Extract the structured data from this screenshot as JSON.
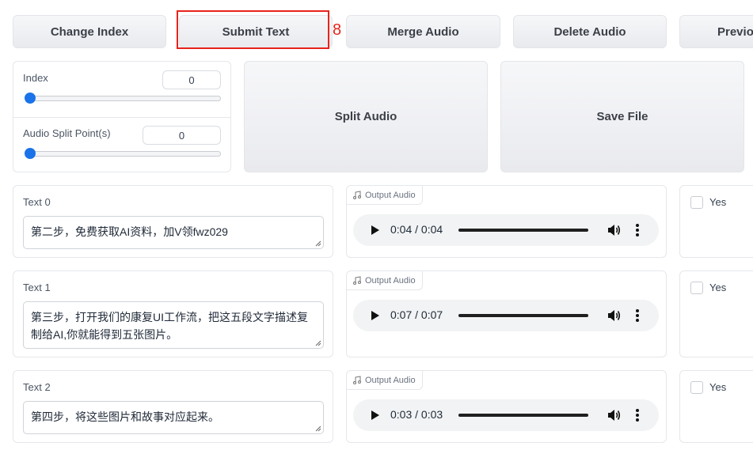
{
  "toolbar": {
    "change_index": "Change Index",
    "submit_text": "Submit Text",
    "merge_audio": "Merge Audio",
    "delete_audio": "Delete Audio",
    "previous": "Previo",
    "annotation_number": "8"
  },
  "controls": {
    "index_label": "Index",
    "index_value": "0",
    "split_label": "Audio Split Point(s)",
    "split_value": "0",
    "split_audio": "Split Audio",
    "save_file": "Save File"
  },
  "rows": [
    {
      "text_label": "Text 0",
      "text_value": "第二步，免费获取AI资料，加V领fwz029",
      "audio_label": "Output Audio",
      "time": "0:04 / 0:04",
      "check_label": "Yes"
    },
    {
      "text_label": "Text 1",
      "text_value": "第三步，打开我们的康复UI工作流，把这五段文字描述复制给AI,你就能得到五张图片。",
      "audio_label": "Output Audio",
      "time": "0:07 / 0:07",
      "check_label": "Yes"
    },
    {
      "text_label": "Text 2",
      "text_value": "第四步，将这些图片和故事对应起来。",
      "audio_label": "Output Audio",
      "time": "0:03 / 0:03",
      "check_label": "Yes"
    }
  ],
  "colors": {
    "accent": "#1a73e8",
    "annotation": "#e8231b"
  },
  "icons": {
    "audio": "music-note-icon",
    "play": "play-icon",
    "volume": "volume-icon",
    "more": "more-vertical-icon"
  }
}
